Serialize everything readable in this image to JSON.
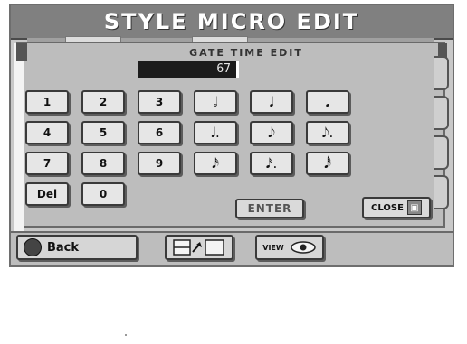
{
  "window": {
    "title": "STYLE MICRO EDIT"
  },
  "editor": {
    "parameter_title": "GATE TIME EDIT",
    "value": "67"
  },
  "keypad": {
    "digits": [
      "1",
      "2",
      "3",
      "4",
      "5",
      "6",
      "7",
      "8",
      "9",
      "0"
    ],
    "del_label": "Del",
    "notes": [
      "𝅗𝅥",
      "𝅘𝅥",
      "𝅘𝅥",
      "𝅘𝅥.",
      "𝅘𝅥𝅮",
      "𝅘𝅥𝅮.",
      "𝅘𝅥𝅯",
      "𝅘𝅥𝅯.",
      "𝅘𝅥𝅰"
    ]
  },
  "actions": {
    "enter_label": "ENTER",
    "close_label": "CLOSE"
  },
  "bottom": {
    "back_label": "Back",
    "view_label": "VIEW"
  },
  "icons": {
    "back": "back-icon",
    "close": "close-icon",
    "edit_toggle": "edit-toggle-icon",
    "view": "eye-icon"
  }
}
